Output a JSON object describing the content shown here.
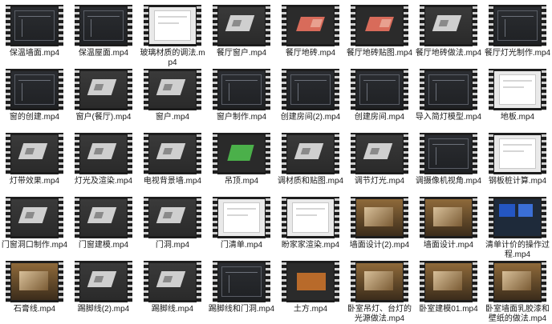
{
  "files": [
    {
      "name": "保温墙面.mp4",
      "thumb": "v-dark"
    },
    {
      "name": "保温屋面.mp4",
      "thumb": "v-dark"
    },
    {
      "name": "玻璃材质的调法.mp4",
      "thumb": "v-light"
    },
    {
      "name": "餐厅窗户.mp4",
      "thumb": "v-room"
    },
    {
      "name": "餐厅地砖.mp4",
      "thumb": "v-red"
    },
    {
      "name": "餐厅地砖贴图.mp4",
      "thumb": "v-red"
    },
    {
      "name": "餐厅地砖做法.mp4",
      "thumb": "v-room"
    },
    {
      "name": "餐厅灯光制作.mp4",
      "thumb": "v-dark"
    },
    {
      "name": "窗的创建.mp4",
      "thumb": "v-dark"
    },
    {
      "name": "窗户(餐厅).mp4",
      "thumb": "v-room"
    },
    {
      "name": "窗户.mp4",
      "thumb": "v-room"
    },
    {
      "name": "窗户制作.mp4",
      "thumb": "v-dark"
    },
    {
      "name": "创建房间(2).mp4",
      "thumb": "v-dark"
    },
    {
      "name": "创建房间.mp4",
      "thumb": "v-dark"
    },
    {
      "name": "导入简灯模型.mp4",
      "thumb": "v-dark"
    },
    {
      "name": "地板.mp4",
      "thumb": "v-light"
    },
    {
      "name": "灯带效果.mp4",
      "thumb": "v-room"
    },
    {
      "name": "灯光及渲染.mp4",
      "thumb": "v-room"
    },
    {
      "name": "电视背景墙.mp4",
      "thumb": "v-room"
    },
    {
      "name": "吊顶.mp4",
      "thumb": "v-green"
    },
    {
      "name": "调材质和贴图.mp4",
      "thumb": "v-room"
    },
    {
      "name": "调节灯光.mp4",
      "thumb": "v-room"
    },
    {
      "name": "调摄像机视角.mp4",
      "thumb": "v-dark"
    },
    {
      "name": "钢板桩计算.mp4",
      "thumb": "v-light"
    },
    {
      "name": "门窗洞口制作.mp4",
      "thumb": "v-room"
    },
    {
      "name": "门窗建模.mp4",
      "thumb": "v-room"
    },
    {
      "name": "门洞.mp4",
      "thumb": "v-room"
    },
    {
      "name": "门清单.mp4",
      "thumb": "v-light"
    },
    {
      "name": "盼家家渲染.mp4",
      "thumb": "v-light"
    },
    {
      "name": "墙面设计(2).mp4",
      "thumb": "v-render"
    },
    {
      "name": "墙面设计.mp4",
      "thumb": "v-render"
    },
    {
      "name": "清单计价的操作过程.mp4",
      "thumb": "v-blue"
    },
    {
      "name": "石膏线.mp4",
      "thumb": "v-render"
    },
    {
      "name": "踢脚线(2).mp4",
      "thumb": "v-room"
    },
    {
      "name": "踢脚线.mp4",
      "thumb": "v-room"
    },
    {
      "name": "踢脚线和门洞.mp4",
      "thumb": "v-dark"
    },
    {
      "name": "土方.mp4",
      "thumb": "v-brown"
    },
    {
      "name": "卧室吊灯、台灯的光源做法.mp4",
      "thumb": "v-render"
    },
    {
      "name": "卧室建模01.mp4",
      "thumb": "v-render"
    },
    {
      "name": "卧室墙面乳胶漆和壁纸的做法.mp4",
      "thumb": "v-render"
    }
  ]
}
